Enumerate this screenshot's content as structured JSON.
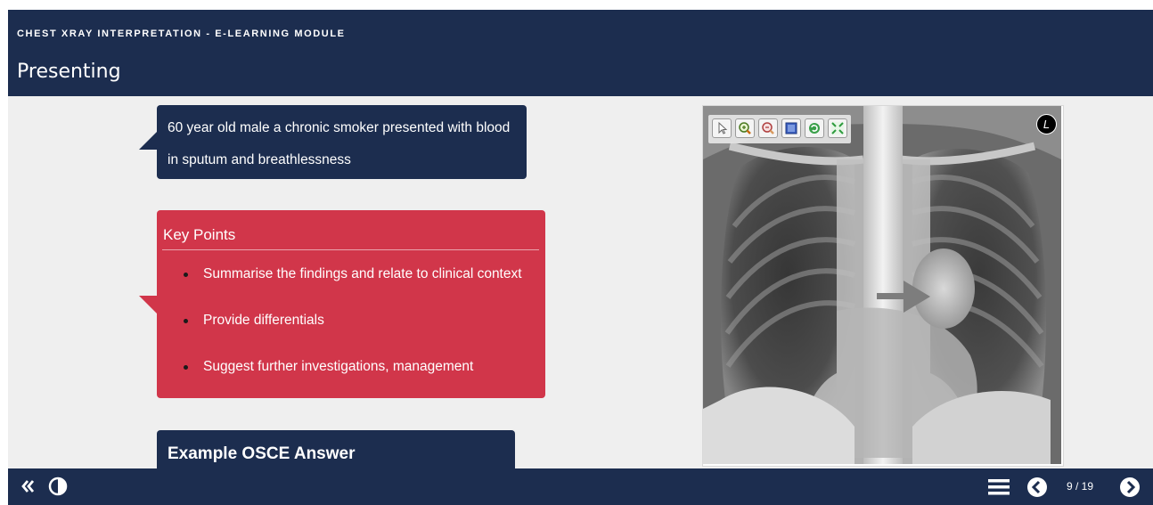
{
  "header": {
    "module_title": "CHEST XRAY INTERPRETATION - E-LEARNING MODULE",
    "page_title": "Presenting"
  },
  "case": {
    "line1": "60 year old male a chronic smoker presented with blood",
    "line2": "in sputum and breathlessness"
  },
  "key_points": {
    "title": "Key Points",
    "items": [
      {
        "label": "Summarise the findings and relate to clinical context"
      },
      {
        "label": "Provide differentials"
      },
      {
        "label": "Suggest further investigations, management"
      }
    ]
  },
  "osce": {
    "title": "Example OSCE Answer"
  },
  "viewer": {
    "orientation_marker": "L",
    "tools": [
      "pointer-icon",
      "zoom-in-icon",
      "zoom-out-icon",
      "fit-icon",
      "rotate-icon",
      "fullscreen-icon"
    ]
  },
  "footer": {
    "page_counter": "9 / 19"
  },
  "colors": {
    "navy": "#1c2d4f",
    "red": "#d1364a",
    "background": "#efefef"
  }
}
